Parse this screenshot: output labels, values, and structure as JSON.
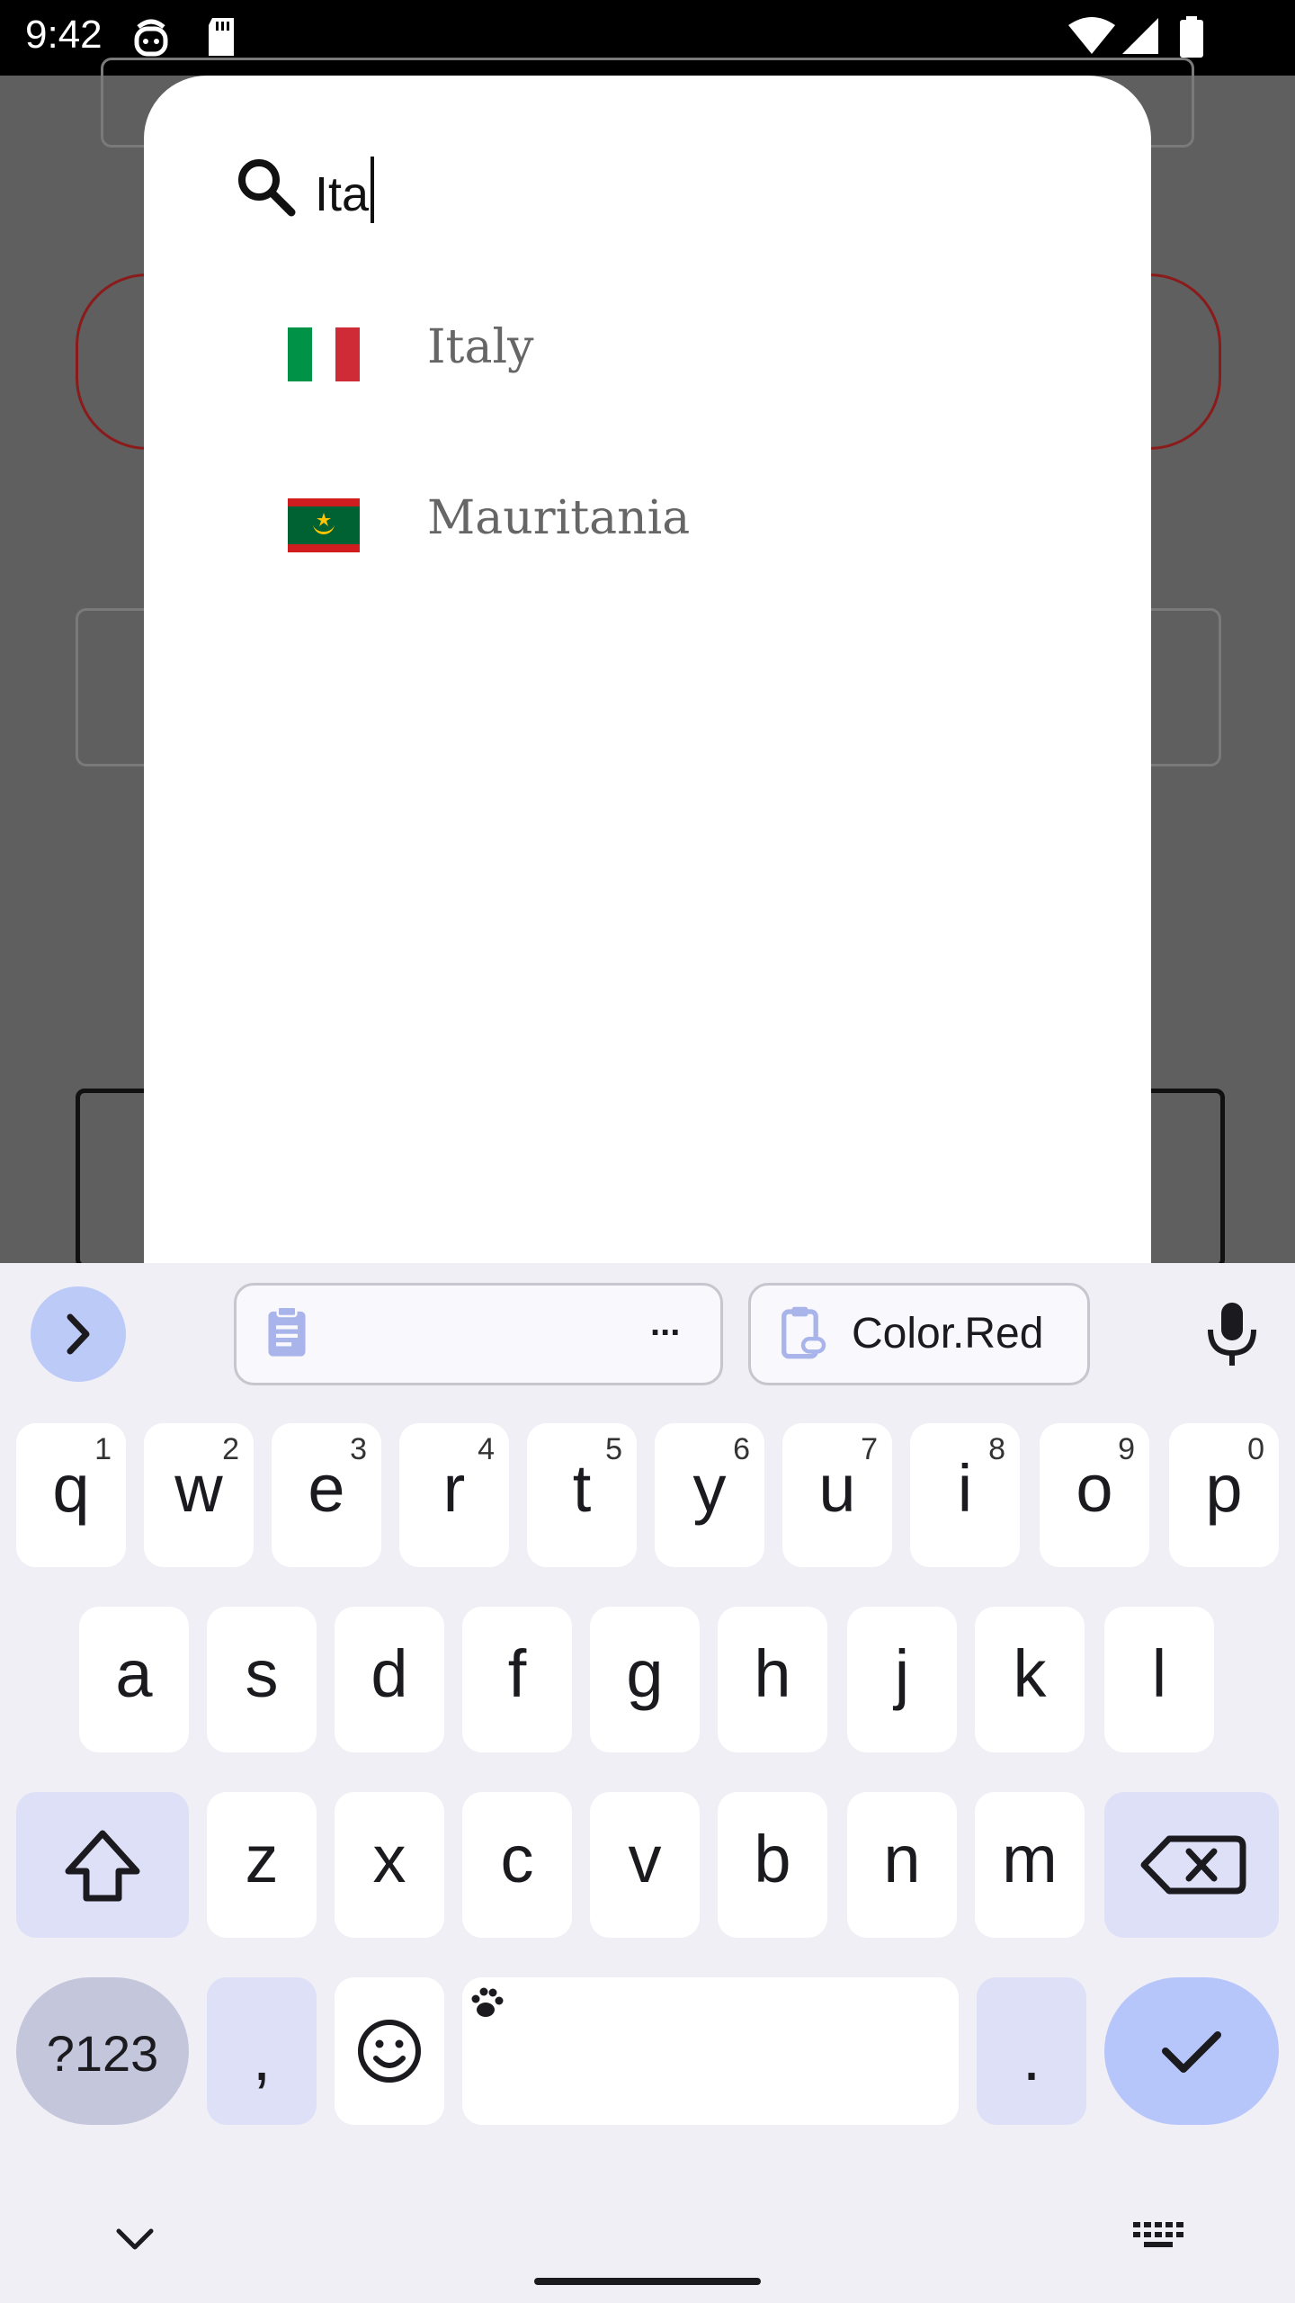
{
  "status_bar": {
    "time": "9:42"
  },
  "dialog": {
    "search": {
      "value": "Ita"
    },
    "results": [
      {
        "name": "Italy",
        "flag_colors": [
          "#009246",
          "#ffffff",
          "#ce2b37"
        ]
      },
      {
        "name": "Mauritania",
        "flag_colors": [
          "#006233",
          "#d01c1f",
          "#ffc400"
        ]
      }
    ]
  },
  "keyboard": {
    "clipboard_chip": {
      "label": "..."
    },
    "suggestion_chip": {
      "label": "Color.Red"
    },
    "row1": [
      {
        "k": "q",
        "n": "1"
      },
      {
        "k": "w",
        "n": "2"
      },
      {
        "k": "e",
        "n": "3"
      },
      {
        "k": "r",
        "n": "4"
      },
      {
        "k": "t",
        "n": "5"
      },
      {
        "k": "y",
        "n": "6"
      },
      {
        "k": "u",
        "n": "7"
      },
      {
        "k": "i",
        "n": "8"
      },
      {
        "k": "o",
        "n": "9"
      },
      {
        "k": "p",
        "n": "0"
      }
    ],
    "row2": [
      "a",
      "s",
      "d",
      "f",
      "g",
      "h",
      "j",
      "k",
      "l"
    ],
    "row3": [
      "z",
      "x",
      "c",
      "v",
      "b",
      "n",
      "m"
    ],
    "sym_label": "?123",
    "comma": ",",
    "period": ".",
    "colors": {
      "accent": "#bccaf8",
      "fn_key": "#dde0f7",
      "key": "#ffffff",
      "background": "#f1eff6"
    }
  }
}
